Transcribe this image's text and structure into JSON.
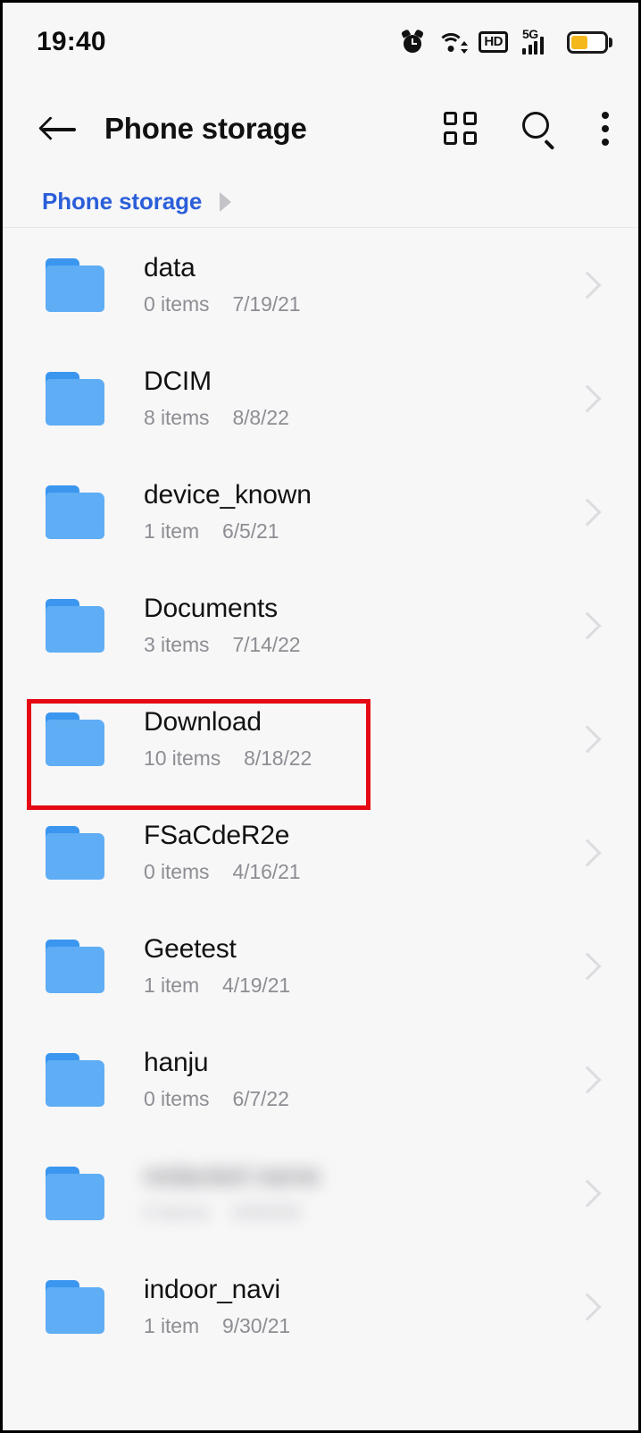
{
  "status_bar": {
    "time": "19:40",
    "icons": [
      "alarm-icon",
      "wifi-icon",
      "hd-icon",
      "signal-5g-icon",
      "battery-icon"
    ],
    "hd_label": "HD",
    "network_label": "5G",
    "battery_level_percent": 45,
    "battery_fill_color": "#f5b81c"
  },
  "app_bar": {
    "back_label": "back-arrow",
    "title": "Phone storage",
    "actions": [
      {
        "name": "grid-view-icon",
        "label": "Grid view"
      },
      {
        "name": "search-icon",
        "label": "Search"
      },
      {
        "name": "more-options-icon",
        "label": "More options"
      }
    ]
  },
  "breadcrumb": {
    "items": [
      {
        "label": "Phone storage"
      }
    ],
    "separator": "chevron-right-icon",
    "link_color": "#2b5fd9"
  },
  "files": {
    "rows": [
      {
        "name": "data",
        "count": "0 items",
        "date": "7/19/21",
        "blurred": false
      },
      {
        "name": "DCIM",
        "count": "8 items",
        "date": "8/8/22",
        "blurred": false
      },
      {
        "name": "device_known",
        "count": "1 item",
        "date": "6/5/21",
        "blurred": false
      },
      {
        "name": "Documents",
        "count": "3 items",
        "date": "7/14/22",
        "blurred": false
      },
      {
        "name": "Download",
        "count": "10 items",
        "date": "8/18/22",
        "blurred": false
      },
      {
        "name": "FSaCdeR2e",
        "count": "0 items",
        "date": "4/16/21",
        "blurred": false
      },
      {
        "name": "Geetest",
        "count": "1 item",
        "date": "4/19/21",
        "blurred": false
      },
      {
        "name": "hanju",
        "count": "0 items",
        "date": "6/7/22",
        "blurred": false
      },
      {
        "name": "redacted name",
        "count": "0 items",
        "date": "0/00/00",
        "blurred": true
      },
      {
        "name": "indoor_navi",
        "count": "1 item",
        "date": "9/30/21",
        "blurred": false
      }
    ],
    "folder_icon": "folder-icon",
    "folder_color": "#5fadf5",
    "folder_tab_color": "#3b96ef",
    "row_chevron": "chevron-right-icon"
  },
  "annotation": {
    "highlight_target": "Download",
    "border_color": "#e50914"
  }
}
